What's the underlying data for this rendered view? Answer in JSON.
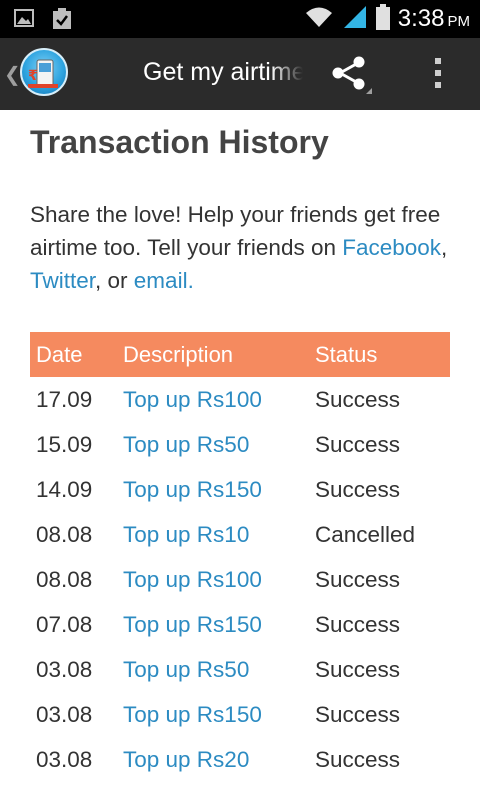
{
  "status_bar": {
    "time": "3:38",
    "ampm": "PM",
    "icons": [
      "gallery-icon",
      "clipboard-check-icon",
      "wifi-icon",
      "signal-icon",
      "battery-icon"
    ]
  },
  "action_bar": {
    "title": "Get my airtime",
    "icons": [
      "up-chevron-icon",
      "app-logo",
      "share-icon",
      "overflow-menu-icon"
    ]
  },
  "page": {
    "title": "Transaction History",
    "share_intro": "Share the love! Help your friends get free airtime too. Tell your friends on ",
    "links": {
      "facebook": "Facebook",
      "sep1": ", ",
      "twitter": "Twitter",
      "sep2": ", or ",
      "email": "email."
    }
  },
  "table": {
    "header_color": "#f58a5f",
    "link_color": "#2c8bc2",
    "columns": [
      "Date",
      "Description",
      "Status"
    ],
    "rows": [
      {
        "date": "17.09",
        "description": "Top up Rs100",
        "status": "Success"
      },
      {
        "date": "15.09",
        "description": "Top up Rs50",
        "status": "Success"
      },
      {
        "date": "14.09",
        "description": "Top up Rs150",
        "status": "Success"
      },
      {
        "date": "08.08",
        "description": "Top up Rs10",
        "status": "Cancelled"
      },
      {
        "date": "08.08",
        "description": "Top up Rs100",
        "status": "Success"
      },
      {
        "date": "07.08",
        "description": "Top up Rs150",
        "status": "Success"
      },
      {
        "date": "03.08",
        "description": "Top up Rs50",
        "status": "Success"
      },
      {
        "date": "03.08",
        "description": "Top up Rs150",
        "status": "Success"
      },
      {
        "date": "03.08",
        "description": "Top up Rs20",
        "status": "Success"
      }
    ]
  }
}
